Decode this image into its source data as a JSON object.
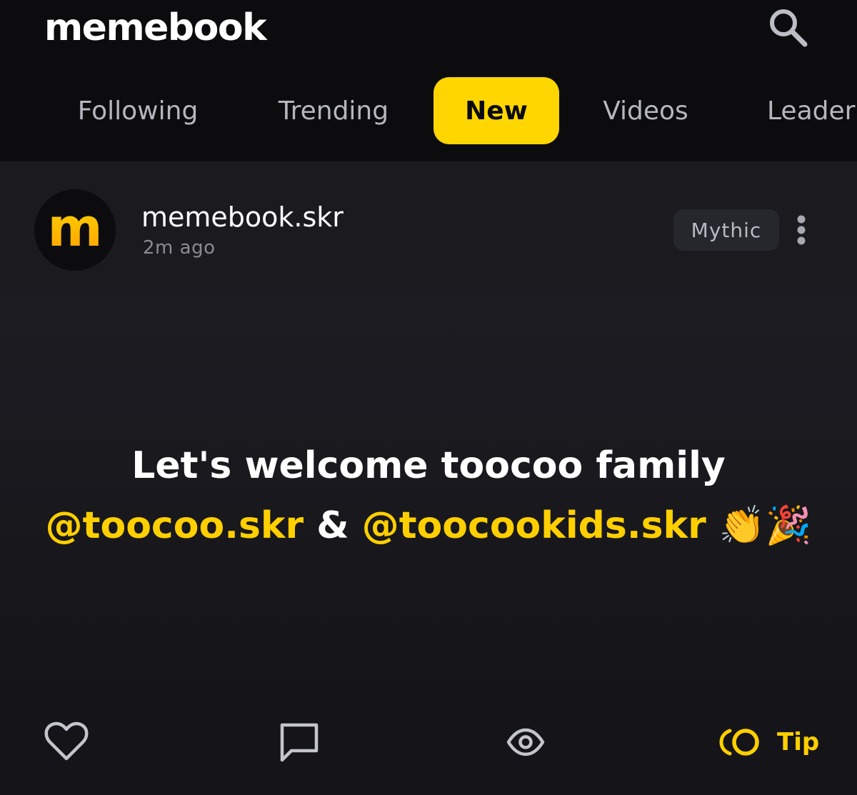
{
  "header": {
    "brand": "memebook",
    "search_icon": "search-icon"
  },
  "tabs": [
    {
      "label": "Following",
      "active": false
    },
    {
      "label": "Trending",
      "active": false
    },
    {
      "label": "New",
      "active": true
    },
    {
      "label": "Videos",
      "active": false
    },
    {
      "label": "Leaderb",
      "active": false
    }
  ],
  "post": {
    "author": "memebook.skr",
    "avatar_letter": "m",
    "time": "2m ago",
    "badge": "Mythic",
    "text": {
      "line1": "Let's welcome toocoo family",
      "mention1": "@toocoo.skr",
      "joiner": " & ",
      "mention2": "@toocookids.skr",
      "emojis": "👏🎉"
    }
  },
  "actions": {
    "like_icon": "heart-icon",
    "comment_icon": "comment-icon",
    "views_icon": "eye-icon",
    "tip_icon": "coin-icon",
    "tip_label": "Tip"
  },
  "colors": {
    "accent": "#ffd600",
    "mention": "#ffcf00",
    "background": "#151519",
    "header_bg": "#0c0c0f"
  }
}
